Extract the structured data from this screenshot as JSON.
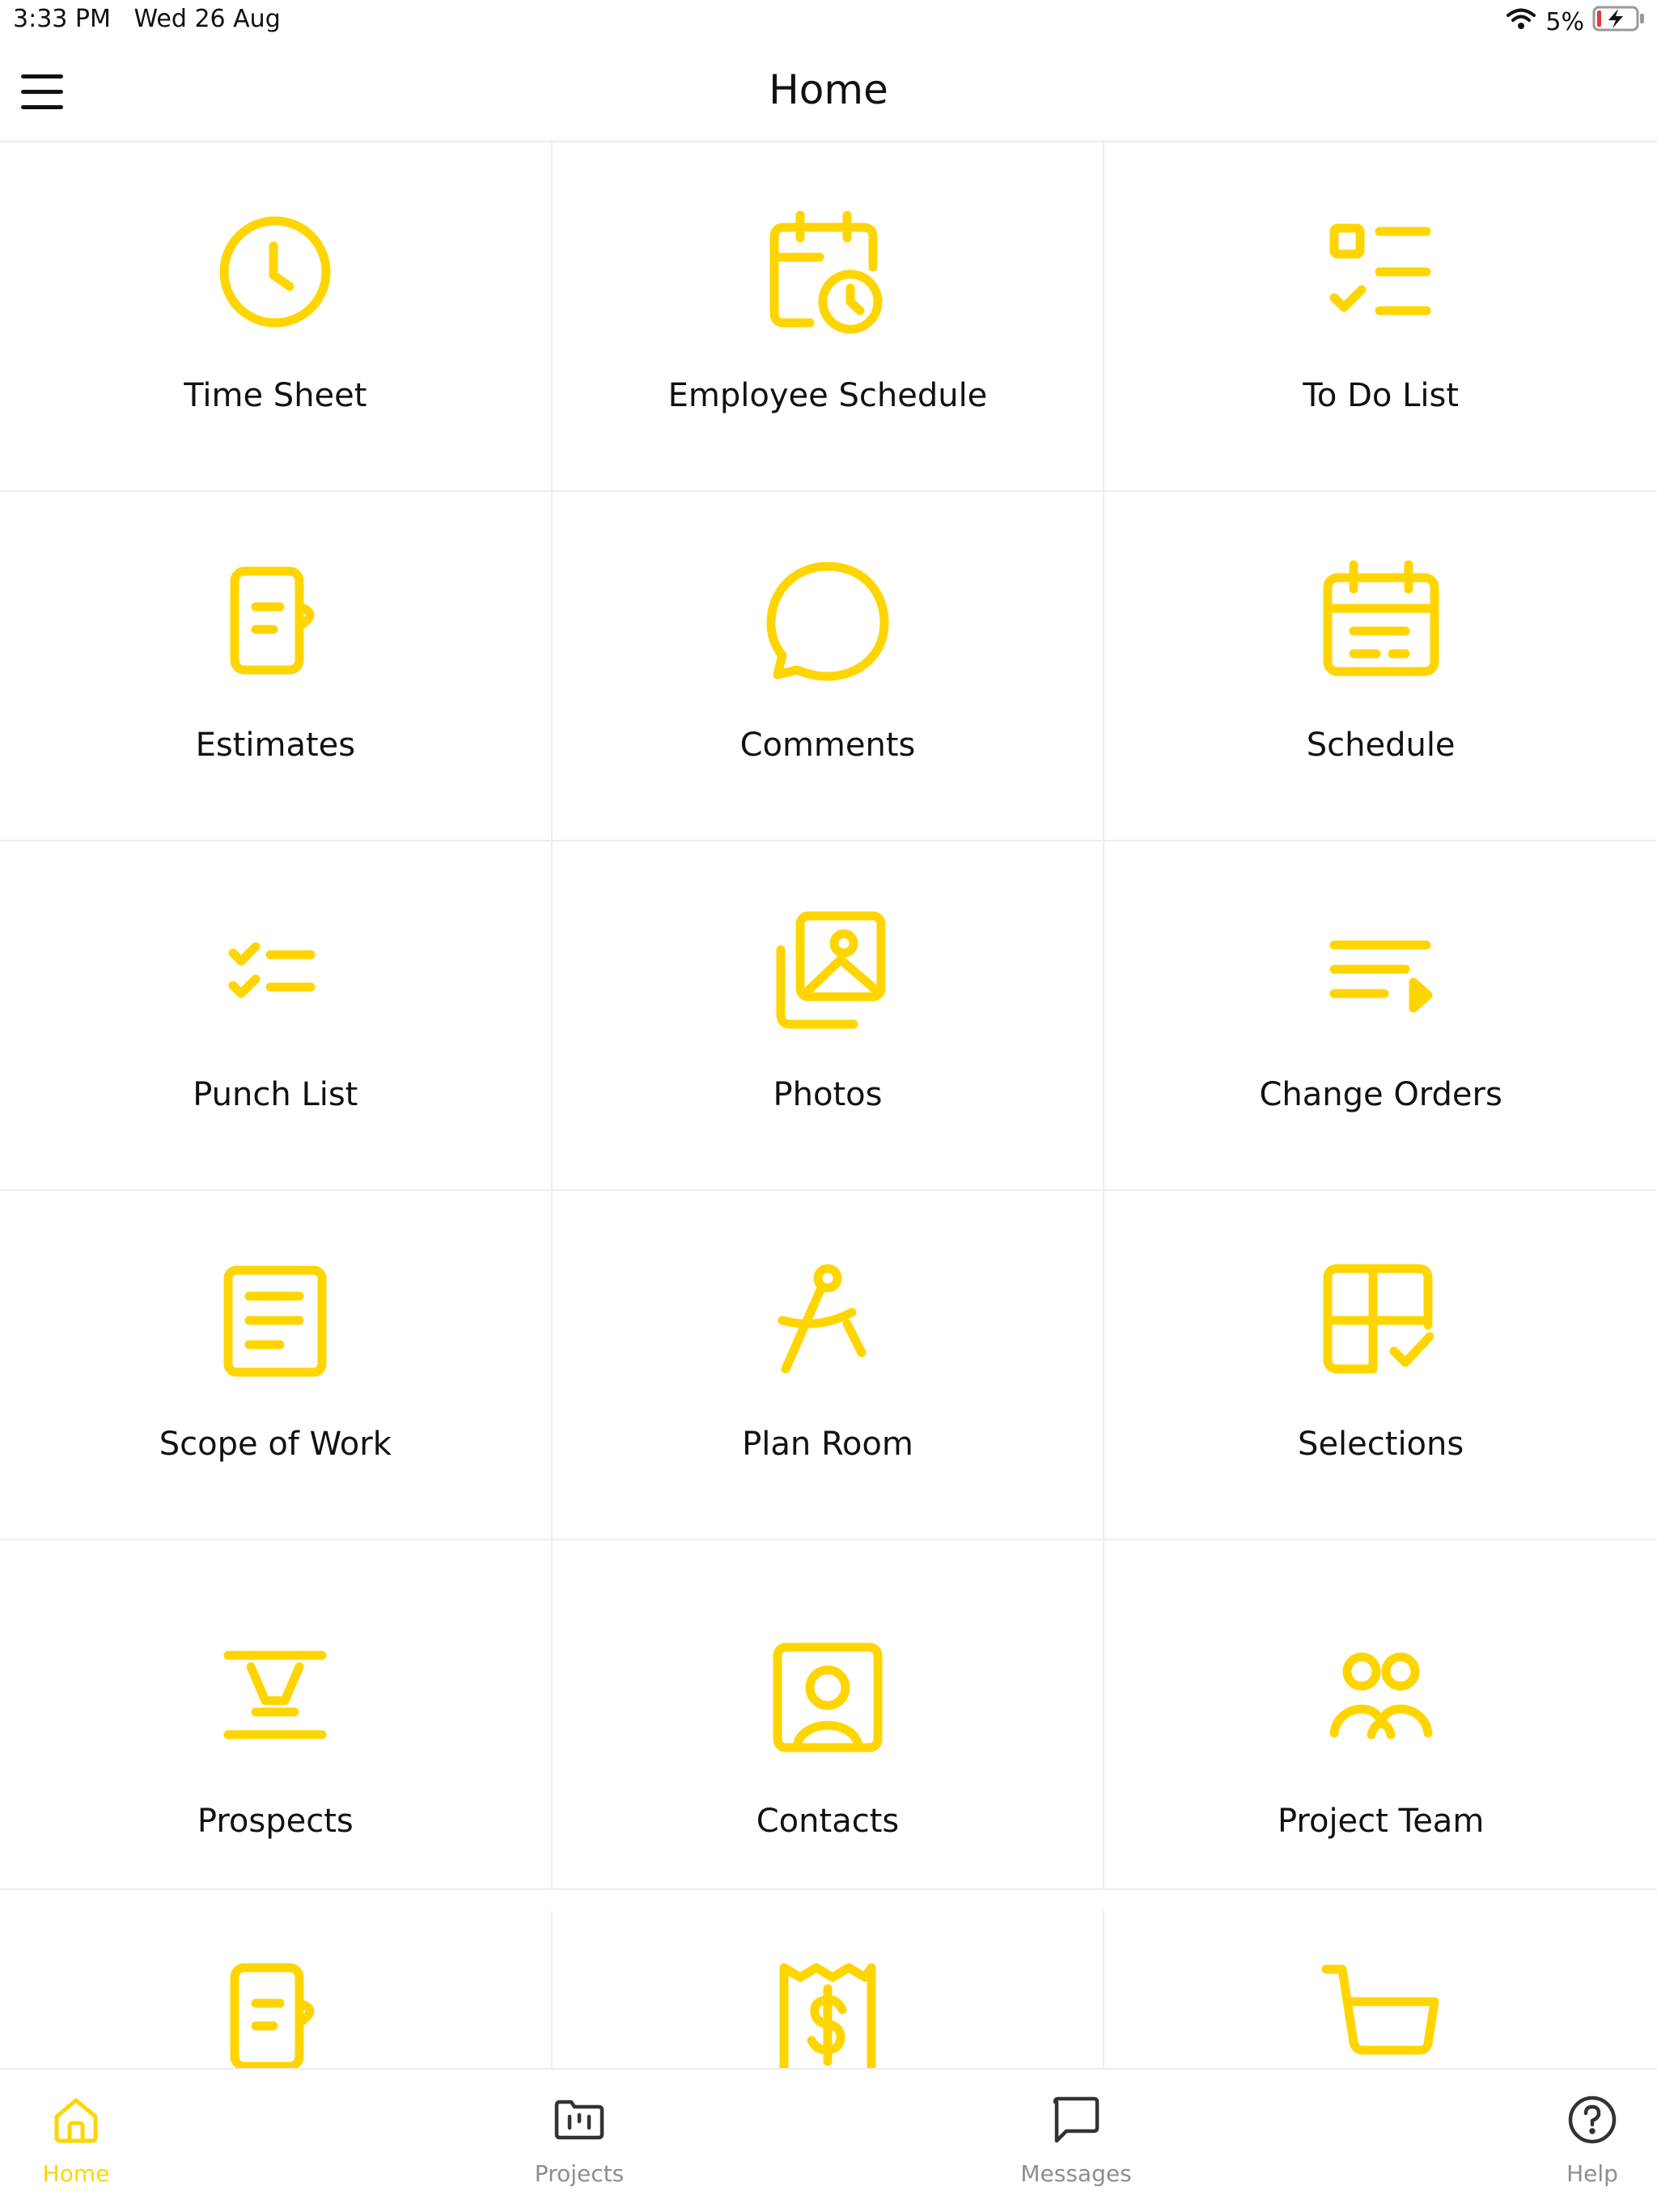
{
  "status_bar": {
    "time": "3:33 PM",
    "date": "Wed 26 Aug",
    "battery_percent": "5%"
  },
  "header": {
    "title": "Home",
    "menu_icon": "hamburger-menu-icon"
  },
  "accent_color": "#FFD500",
  "tiles": [
    {
      "label": "Time Sheet",
      "icon": "clock-icon"
    },
    {
      "label": "Employee Schedule",
      "icon": "calendar-clock-icon"
    },
    {
      "label": "To Do List",
      "icon": "checklist-icon"
    },
    {
      "label": "Estimates",
      "icon": "estimate-document-icon"
    },
    {
      "label": "Comments",
      "icon": "chat-bubble-icon"
    },
    {
      "label": "Schedule",
      "icon": "calendar-icon"
    },
    {
      "label": "Punch List",
      "icon": "check-list-icon"
    },
    {
      "label": "Photos",
      "icon": "photos-icon"
    },
    {
      "label": "Change Orders",
      "icon": "change-order-icon"
    },
    {
      "label": "Scope of Work",
      "icon": "document-icon"
    },
    {
      "label": "Plan Room",
      "icon": "compass-drafting-icon"
    },
    {
      "label": "Selections",
      "icon": "selection-grid-icon"
    },
    {
      "label": "Prospects",
      "icon": "prospect-icon"
    },
    {
      "label": "Contacts",
      "icon": "contact-card-icon"
    },
    {
      "label": "Project Team",
      "icon": "team-icon"
    },
    {
      "label": "",
      "icon": "invoice-document-icon"
    },
    {
      "label": "",
      "icon": "receipt-dollar-icon"
    },
    {
      "label": "",
      "icon": "shopping-basket-icon"
    }
  ],
  "tab_bar": {
    "active": "Home",
    "items": [
      {
        "label": "Home",
        "icon": "home-icon"
      },
      {
        "label": "Projects",
        "icon": "projects-board-icon"
      },
      {
        "label": "Messages",
        "icon": "message-icon"
      },
      {
        "label": "Help",
        "icon": "help-circle-icon"
      }
    ]
  }
}
